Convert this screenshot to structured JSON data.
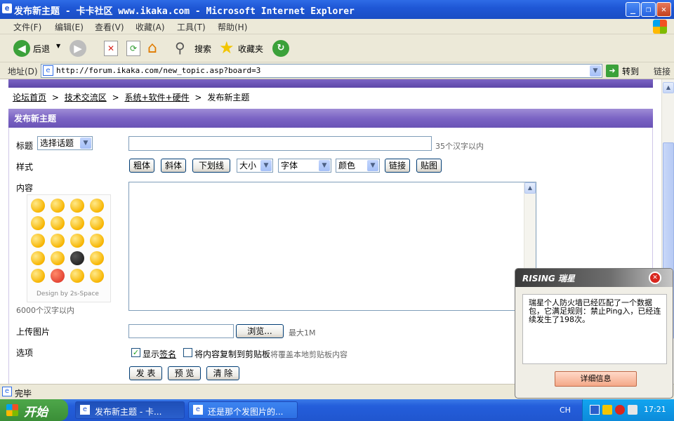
{
  "window": {
    "title": "发布新主题 - 卡卡社区 www.ikaka.com - Microsoft Internet Explorer",
    "minimize": "_",
    "maximize": "❐",
    "close": "✕"
  },
  "menu": [
    "文件(F)",
    "编辑(E)",
    "查看(V)",
    "收藏(A)",
    "工具(T)",
    "帮助(H)"
  ],
  "toolbar": {
    "back": "后退",
    "search": "搜索",
    "favorites": "收藏夹"
  },
  "address": {
    "label": "地址(D)",
    "url": "http://forum.ikaka.com/new_topic.asp?board=3",
    "go": "转到",
    "links": "链接"
  },
  "breadcrumb": {
    "home": "论坛首页",
    "sep": ">",
    "forum": "技术交流区",
    "board": "系统+软件+硬件",
    "current": "发布新主题"
  },
  "form": {
    "header": "发布新主题",
    "title_label": "标题",
    "topic_select": "选择话题",
    "title_hint": "35个汉字以内",
    "style_label": "样式",
    "style_buttons": [
      "粗体",
      "斜体",
      "下划线"
    ],
    "size_select": "大小",
    "font_select": "字体",
    "color_select": "颜色",
    "link_button": "链接",
    "image_button": "贴图",
    "content_label": "内容",
    "emoticon_credit": "Design by 2s-Space",
    "content_hint": "6000个汉字以内",
    "upload_label": "上传图片",
    "browse_button": "浏览...",
    "upload_hint": "最大1M",
    "options_label": "选项",
    "option_signature_prefix": "显示",
    "option_signature_link": "签名",
    "option_signature_checked": true,
    "option_clipboard": "将内容复制到剪贴板",
    "option_clipboard_hint": "将覆盖本地剪贴板内容",
    "option_clipboard_checked": false,
    "submit": "发 表",
    "preview": "预 览",
    "clear": "清 除"
  },
  "status": {
    "text": "完毕"
  },
  "taskbar": {
    "start": "开始",
    "tasks": [
      "发布新主题 - 卡...",
      "还是那个发图片的..."
    ],
    "lang": "CH",
    "clock": "17:21"
  },
  "popup": {
    "brand": "RISING 瑞星",
    "message": "瑞星个人防火墙已经匹配了一个数据包，它满足规则：禁止Ping入，已经连续发生了198次。",
    "details_button": "详细信息"
  },
  "colors": {
    "accent": "#7B64C4",
    "titlebar": "#1F57D6",
    "taskbar": "#245EDB"
  }
}
